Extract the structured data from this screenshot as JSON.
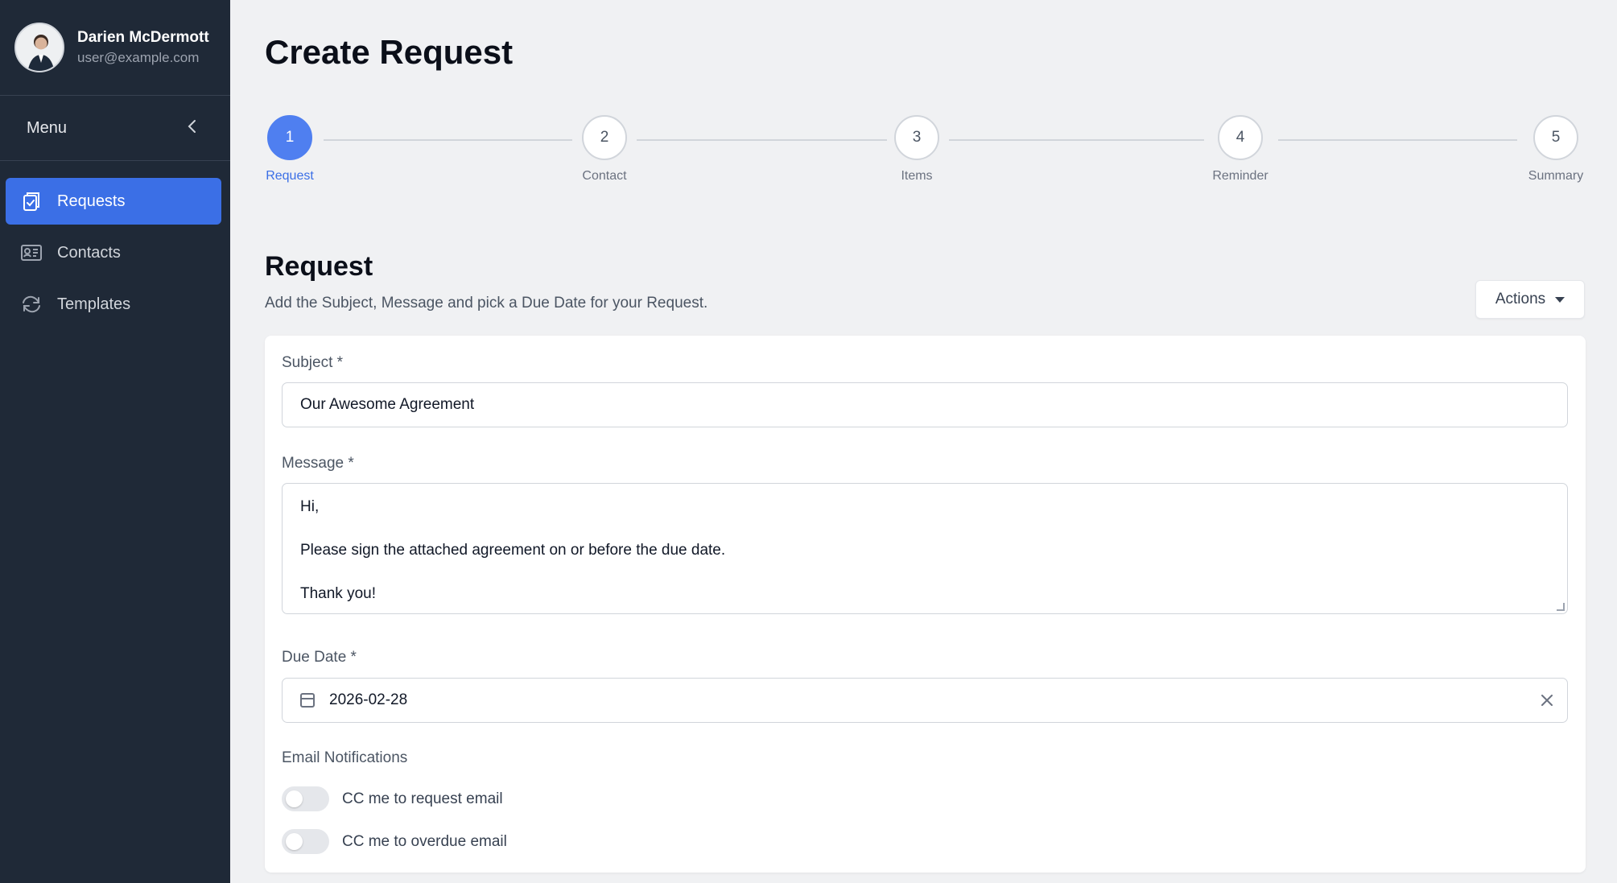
{
  "user": {
    "name": "Darien McDermott",
    "email": "user@example.com"
  },
  "sidebar": {
    "menu_label": "Menu",
    "items": [
      {
        "label": "Requests",
        "icon": "clipboard-check-icon",
        "active": true
      },
      {
        "label": "Contacts",
        "icon": "id-card-icon",
        "active": false
      },
      {
        "label": "Templates",
        "icon": "sync-arrows-icon",
        "active": false
      }
    ]
  },
  "page": {
    "title": "Create Request"
  },
  "stepper": {
    "steps": [
      {
        "number": "1",
        "label": "Request",
        "active": true
      },
      {
        "number": "2",
        "label": "Contact",
        "active": false
      },
      {
        "number": "3",
        "label": "Items",
        "active": false
      },
      {
        "number": "4",
        "label": "Reminder",
        "active": false
      },
      {
        "number": "5",
        "label": "Summary",
        "active": false
      }
    ]
  },
  "section": {
    "title": "Request",
    "description": "Add the Subject, Message and pick a Due Date for your Request.",
    "actions_label": "Actions"
  },
  "form": {
    "subject_label": "Subject *",
    "subject_value": "Our Awesome Agreement",
    "message_label": "Message *",
    "message_lines": [
      "Hi,",
      "",
      "Please sign the attached agreement on or before the due date.",
      "",
      "Thank you!"
    ],
    "due_date_label": "Due Date *",
    "due_date_value": "2026-02-28",
    "notifications_label": "Email Notifications",
    "toggles": [
      {
        "label": "CC me to request email",
        "on": false
      },
      {
        "label": "CC me to overdue email",
        "on": false
      }
    ]
  },
  "colors": {
    "sidebar_bg": "#1f2937",
    "accent": "#3b6fe6",
    "page_bg": "#f0f1f3"
  }
}
